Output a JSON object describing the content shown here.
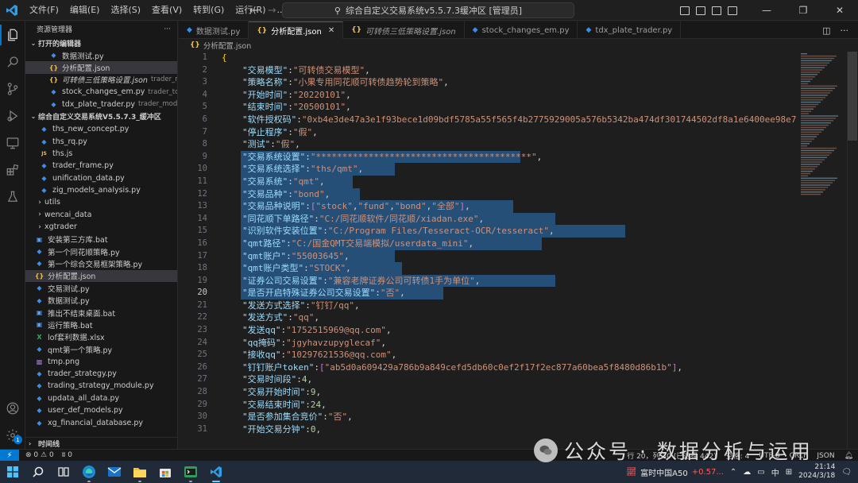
{
  "titlebar": {
    "menu": [
      "文件(F)",
      "编辑(E)",
      "选择(S)",
      "查看(V)",
      "转到(G)",
      "运行(R)",
      "..."
    ],
    "search_text": "综合自定义交易系统v5.5.7.3缓冲区 [管理员]"
  },
  "sidebar": {
    "title": "资源管理器",
    "open_editors_title": "打开的编辑器",
    "open_editors": [
      {
        "name": "数据测试.py",
        "desc": "",
        "type": "py",
        "italic": false,
        "selected": false
      },
      {
        "name": "分析配置.json",
        "desc": "",
        "type": "json",
        "italic": false,
        "selected": true
      },
      {
        "name": "可转债三低策略设置.json",
        "desc": "trader_m...",
        "type": "json",
        "italic": true,
        "selected": false
      },
      {
        "name": "stock_changes_em.py",
        "desc": "trader_tool",
        "type": "py",
        "italic": false,
        "selected": false
      },
      {
        "name": "tdx_plate_trader.py",
        "desc": "trader_models\\...",
        "type": "py",
        "italic": false,
        "selected": false
      }
    ],
    "workspace_title": "综合自定义交易系统V5.5.7.3_缓冲区",
    "files": [
      {
        "name": "ths_new_concept.py",
        "type": "py",
        "folder": false
      },
      {
        "name": "ths_rq.py",
        "type": "py",
        "folder": false
      },
      {
        "name": "ths.js",
        "type": "js",
        "folder": false
      },
      {
        "name": "trader_frame.py",
        "type": "py",
        "folder": false
      },
      {
        "name": "unification_data.py",
        "type": "py",
        "folder": false
      },
      {
        "name": "zig_models_analysis.py",
        "type": "py",
        "folder": false
      },
      {
        "name": "utils",
        "type": "folder",
        "folder": true
      },
      {
        "name": "wencai_data",
        "type": "folder",
        "folder": true
      },
      {
        "name": "xgtrader",
        "type": "folder",
        "folder": true
      },
      {
        "name": "安装第三方库.bat",
        "type": "bat",
        "folder": false,
        "top": true
      },
      {
        "name": "第一个同花顺策略.py",
        "type": "py",
        "folder": false,
        "top": true
      },
      {
        "name": "第一个综合交易框架策略.py",
        "type": "py",
        "folder": false,
        "top": true
      },
      {
        "name": "分析配置.json",
        "type": "json",
        "folder": false,
        "top": true,
        "selected": true
      },
      {
        "name": "交易测试.py",
        "type": "py",
        "folder": false,
        "top": true
      },
      {
        "name": "数据测试.py",
        "type": "py",
        "folder": false,
        "top": true
      },
      {
        "name": "推出不结束桌面.bat",
        "type": "bat",
        "folder": false,
        "top": true
      },
      {
        "name": "运行策略.bat",
        "type": "bat",
        "folder": false,
        "top": true
      },
      {
        "name": "lof套利数据.xlsx",
        "type": "xlsx",
        "folder": false,
        "top": true
      },
      {
        "name": "qmt第一个策略.py",
        "type": "py",
        "folder": false,
        "top": true
      },
      {
        "name": "tmp.png",
        "type": "png",
        "folder": false,
        "top": true
      },
      {
        "name": "trader_strategy.py",
        "type": "py",
        "folder": false,
        "top": true
      },
      {
        "name": "trading_strategy_module.py",
        "type": "py",
        "folder": false,
        "top": true
      },
      {
        "name": "updata_all_data.py",
        "type": "py",
        "folder": false,
        "top": true
      },
      {
        "name": "user_def_models.py",
        "type": "py",
        "folder": false,
        "top": true
      },
      {
        "name": "xg_financial_database.py",
        "type": "py",
        "folder": false,
        "top": true
      }
    ],
    "timeline_title": "时间线"
  },
  "tabs": [
    {
      "label": "数据测试.py",
      "type": "py",
      "active": false,
      "italic": false
    },
    {
      "label": "分析配置.json",
      "type": "json",
      "active": true,
      "italic": false
    },
    {
      "label": "可转债三低策略设置.json",
      "type": "json",
      "active": false,
      "italic": true
    },
    {
      "label": "stock_changes_em.py",
      "type": "py",
      "active": false,
      "italic": false
    },
    {
      "label": "tdx_plate_trader.py",
      "type": "py",
      "active": false,
      "italic": false
    }
  ],
  "breadcrumb": "分析配置.json",
  "editor": {
    "current_line": 20,
    "lines": [
      {
        "n": 1,
        "t": [
          [
            "br",
            "{"
          ]
        ]
      },
      {
        "n": 2,
        "t": [
          [
            "k",
            "\"交易模型\""
          ],
          [
            "p",
            ":"
          ],
          [
            "s",
            "\"可转债交易模型\""
          ],
          [
            "p",
            ","
          ]
        ]
      },
      {
        "n": 3,
        "t": [
          [
            "k",
            "\"策略名称\""
          ],
          [
            "p",
            ":"
          ],
          [
            "s",
            "\"小果专用同花顺可转债趋势轮到策略\""
          ],
          [
            "p",
            ","
          ]
        ]
      },
      {
        "n": 4,
        "t": [
          [
            "k",
            "\"开始时间\""
          ],
          [
            "p",
            ":"
          ],
          [
            "s",
            "\"20220101\""
          ],
          [
            "p",
            ","
          ]
        ]
      },
      {
        "n": 5,
        "t": [
          [
            "k",
            "\"结束时间\""
          ],
          [
            "p",
            ":"
          ],
          [
            "s",
            "\"20500101\""
          ],
          [
            "p",
            ","
          ]
        ]
      },
      {
        "n": 6,
        "t": [
          [
            "k",
            "\"软件授权码\""
          ],
          [
            "p",
            ":"
          ],
          [
            "s",
            "\"0xb4e3de47a3e1f93bece1d09bdf5785a55f565f4b2775929005a576b5342ba474df301744502df8a1e6400ee98e7"
          ]
        ]
      },
      {
        "n": 7,
        "t": [
          [
            "k",
            "\"停止程序\""
          ],
          [
            "p",
            ":"
          ],
          [
            "s",
            "\"假\""
          ],
          [
            "p",
            ","
          ]
        ]
      },
      {
        "n": 8,
        "t": [
          [
            "k",
            "\"测试\""
          ],
          [
            "p",
            ":"
          ],
          [
            "s",
            "\"假\""
          ],
          [
            "p",
            ","
          ]
        ]
      },
      {
        "n": 9,
        "t": [
          [
            "k",
            "\"交易系统设置\""
          ],
          [
            "p",
            ":"
          ],
          [
            "s",
            "\"*****************************************\""
          ],
          [
            "p",
            ","
          ]
        ],
        "sel": 40
      },
      {
        "n": 10,
        "t": [
          [
            "k",
            "\"交易系统选择\""
          ],
          [
            "p",
            ":"
          ],
          [
            "s",
            "\"ths/qmt\""
          ],
          [
            "p",
            ","
          ]
        ],
        "sel": 22
      },
      {
        "n": 11,
        "t": [
          [
            "k",
            "\"交易系统\""
          ],
          [
            "p",
            ":"
          ],
          [
            "s",
            "\"qmt\""
          ],
          [
            "p",
            ","
          ]
        ],
        "sel": 16
      },
      {
        "n": 12,
        "t": [
          [
            "k",
            "\"交易品种\""
          ],
          [
            "p",
            ":"
          ],
          [
            "s",
            "\"bond\""
          ],
          [
            "p",
            ","
          ]
        ],
        "sel": 17
      },
      {
        "n": 13,
        "t": [
          [
            "k",
            "\"交易品种说明\""
          ],
          [
            "p",
            ":"
          ],
          [
            "br2",
            "["
          ],
          [
            "s",
            "\"stock\""
          ],
          [
            "p",
            ","
          ],
          [
            "s",
            "\"fund\""
          ],
          [
            "p",
            ","
          ],
          [
            "s",
            "\"bond\""
          ],
          [
            "p",
            ","
          ],
          [
            "s",
            "\"全部\""
          ],
          [
            "br2",
            "]"
          ],
          [
            "p",
            ","
          ]
        ],
        "sel": 39
      },
      {
        "n": 14,
        "t": [
          [
            "k",
            "\"同花顺下单路径\""
          ],
          [
            "p",
            ":"
          ],
          [
            "s",
            "\"C:/同花顺软件/同花顺/xiadan.exe\""
          ],
          [
            "p",
            ","
          ]
        ],
        "sel": 45
      },
      {
        "n": 15,
        "t": [
          [
            "k",
            "\"识别软件安装位置\""
          ],
          [
            "p",
            ":"
          ],
          [
            "s",
            "\"C:/Program Files/Tesseract-OCR/tesseract\""
          ],
          [
            "p",
            ","
          ]
        ],
        "sel": 55
      },
      {
        "n": 16,
        "t": [
          [
            "k",
            "\"qmt路径\""
          ],
          [
            "p",
            ":"
          ],
          [
            "s",
            "\"C:/国金QMT交易端模拟/userdata_mini\""
          ],
          [
            "p",
            ","
          ]
        ],
        "sel": 43
      },
      {
        "n": 17,
        "t": [
          [
            "k",
            "\"qmt账户\""
          ],
          [
            "p",
            ":"
          ],
          [
            "s",
            "\"55003645\""
          ],
          [
            "p",
            ","
          ]
        ],
        "sel": 22
      },
      {
        "n": 18,
        "t": [
          [
            "k",
            "\"qmt账户类型\""
          ],
          [
            "p",
            ":"
          ],
          [
            "s",
            "\"STOCK\""
          ],
          [
            "p",
            ","
          ]
        ],
        "sel": 23
      },
      {
        "n": 19,
        "t": [
          [
            "k",
            "\"证券公司交易设置\""
          ],
          [
            "p",
            ":"
          ],
          [
            "s",
            "\"兼容老牌证券公司可转债1手为单位\""
          ],
          [
            "p",
            ","
          ]
        ],
        "sel": 45
      },
      {
        "n": 20,
        "t": [
          [
            "k",
            "\"是否开启特殊证券公司交易设置\""
          ],
          [
            "p",
            ":"
          ],
          [
            "s",
            "\"否\""
          ],
          [
            "p",
            ","
          ]
        ],
        "sel": 29
      },
      {
        "n": 21,
        "t": [
          [
            "k",
            "\"发送方式选择\""
          ],
          [
            "p",
            ":"
          ],
          [
            "s",
            "\"钉钉/qq\""
          ],
          [
            "p",
            ","
          ]
        ]
      },
      {
        "n": 22,
        "t": [
          [
            "k",
            "\"发送方式\""
          ],
          [
            "p",
            ":"
          ],
          [
            "s",
            "\"qq\""
          ],
          [
            "p",
            ","
          ]
        ]
      },
      {
        "n": 23,
        "t": [
          [
            "k",
            "\"发送qq\""
          ],
          [
            "p",
            ":"
          ],
          [
            "s",
            "\"1752515969@qq.com\""
          ],
          [
            "p",
            ","
          ]
        ]
      },
      {
        "n": 24,
        "t": [
          [
            "k",
            "\"qq掩码\""
          ],
          [
            "p",
            ":"
          ],
          [
            "s",
            "\"jgyhavzupyglecaf\""
          ],
          [
            "p",
            ","
          ]
        ]
      },
      {
        "n": 25,
        "t": [
          [
            "k",
            "\"接收qq\""
          ],
          [
            "p",
            ":"
          ],
          [
            "s",
            "\"10297621536@qq.com\""
          ],
          [
            "p",
            ","
          ]
        ]
      },
      {
        "n": 26,
        "t": [
          [
            "k",
            "\"钉钉账户token\""
          ],
          [
            "p",
            ":"
          ],
          [
            "br2",
            "["
          ],
          [
            "s",
            "\"ab5d0a609429a786b9a849cefd5db60c0ef2f17f2ec877a60bea5f8480d86b1b\""
          ],
          [
            "br2",
            "]"
          ],
          [
            "p",
            ","
          ]
        ]
      },
      {
        "n": 27,
        "t": [
          [
            "k",
            "\"交易时间段\""
          ],
          [
            "p",
            ":"
          ],
          [
            "n",
            "4"
          ],
          [
            "p",
            ","
          ]
        ]
      },
      {
        "n": 28,
        "t": [
          [
            "k",
            "\"交易开始时间\""
          ],
          [
            "p",
            ":"
          ],
          [
            "n",
            "9"
          ],
          [
            "p",
            ","
          ]
        ]
      },
      {
        "n": 29,
        "t": [
          [
            "k",
            "\"交易结束时间\""
          ],
          [
            "p",
            ":"
          ],
          [
            "n",
            "24"
          ],
          [
            "p",
            ","
          ]
        ]
      },
      {
        "n": 30,
        "t": [
          [
            "k",
            "\"是否参加集合竞价\""
          ],
          [
            "p",
            ":"
          ],
          [
            "s",
            "\"否\""
          ],
          [
            "p",
            ","
          ]
        ]
      },
      {
        "n": 31,
        "t": [
          [
            "k",
            "\"开始交易分钟\""
          ],
          [
            "p",
            ":"
          ],
          [
            "n",
            "0"
          ],
          [
            "p",
            ","
          ]
        ]
      }
    ]
  },
  "watermark": "公众号 · 数据分析与运用",
  "statusbar": {
    "errors": "0",
    "warnings": "0",
    "ports": "0",
    "position": "行 20，列 30 (已选择 442)",
    "spaces": "空格: 4",
    "encoding": "UTF-8",
    "eol": "CRLF",
    "language": "JSON"
  },
  "taskbar": {
    "stock_name": "富时中国A50",
    "stock_change": "+0.57...",
    "ime": "中",
    "time": "21:14",
    "date": "2024/3/18"
  },
  "colors": {
    "accent": "#0078d4",
    "selection": "#264f78",
    "json_key": "#9cdcfe",
    "json_string": "#ce9178",
    "json_number": "#b5cea8"
  }
}
